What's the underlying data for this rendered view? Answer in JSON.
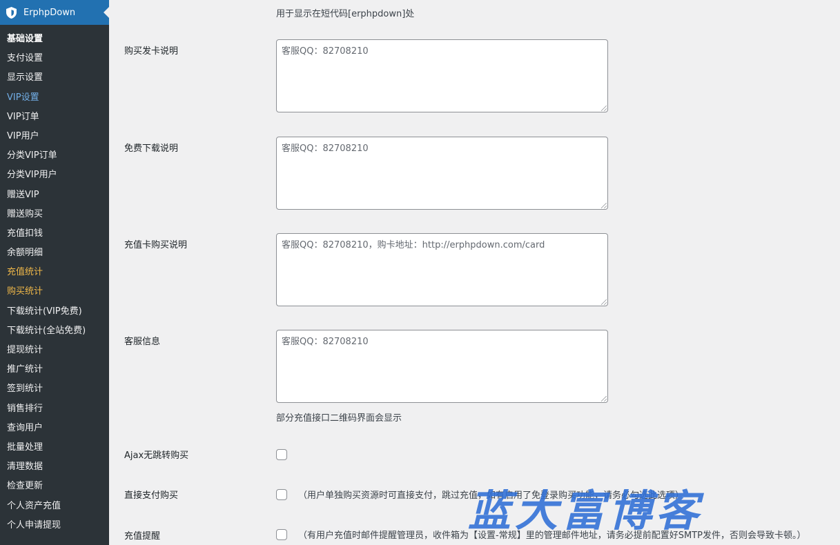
{
  "sidebar": {
    "plugin_title": "ErphpDown",
    "items": [
      {
        "label": "基础设置"
      },
      {
        "label": "支付设置"
      },
      {
        "label": "显示设置"
      },
      {
        "label": "VIP设置"
      },
      {
        "label": "VIP订单"
      },
      {
        "label": "VIP用户"
      },
      {
        "label": "分类VIP订单"
      },
      {
        "label": "分类VIP用户"
      },
      {
        "label": "赠送VIP"
      },
      {
        "label": "赠送购买"
      },
      {
        "label": "充值扣钱"
      },
      {
        "label": "余额明细"
      },
      {
        "label": "充值统计"
      },
      {
        "label": "购买统计"
      },
      {
        "label": "下载统计(VIP免费)"
      },
      {
        "label": "下载统计(全站免费)"
      },
      {
        "label": "提现统计"
      },
      {
        "label": "推广统计"
      },
      {
        "label": "签到统计"
      },
      {
        "label": "销售排行"
      },
      {
        "label": "查询用户"
      },
      {
        "label": "批量处理"
      },
      {
        "label": "清理数据"
      },
      {
        "label": "检查更新"
      },
      {
        "label": "个人资产充值"
      },
      {
        "label": "个人申请提现"
      }
    ],
    "colors": {
      "background": "#2c3338",
      "header": "#2271b1",
      "highlight_blue": "#72aee6",
      "highlight_orange": "#f0b849"
    }
  },
  "form": {
    "top_desc": "用于显示在短代码[erphpdown]处",
    "card_purchase": {
      "label": "购买发卡说明",
      "placeholder": "客服QQ：82708210"
    },
    "free_download": {
      "label": "免费下载说明",
      "placeholder": "客服QQ：82708210"
    },
    "recharge_card": {
      "label": "充值卡购买说明",
      "placeholder": "客服QQ：82708210，购卡地址：http://erphpdown.com/card"
    },
    "service_info": {
      "label": "客服信息",
      "placeholder": "客服QQ：82708210",
      "desc": "部分充值接口二维码界面会显示"
    },
    "ajax_buy": {
      "label": "Ajax无跳转购买"
    },
    "direct_pay": {
      "label": "直接支付购买",
      "desc": "（用户单独购买资源时可直接支付，跳过充值，如有启用了免登录购买功能，请务必勾选此选项）"
    },
    "recharge_notify": {
      "label": "充值提醒",
      "desc": "（有用户充值时邮件提醒管理员，收件箱为【设置-常规】里的管理邮件地址，请务必提前配置好SMTP发件，否则会导致卡顿。）"
    }
  },
  "watermark": "蓝大富博客"
}
